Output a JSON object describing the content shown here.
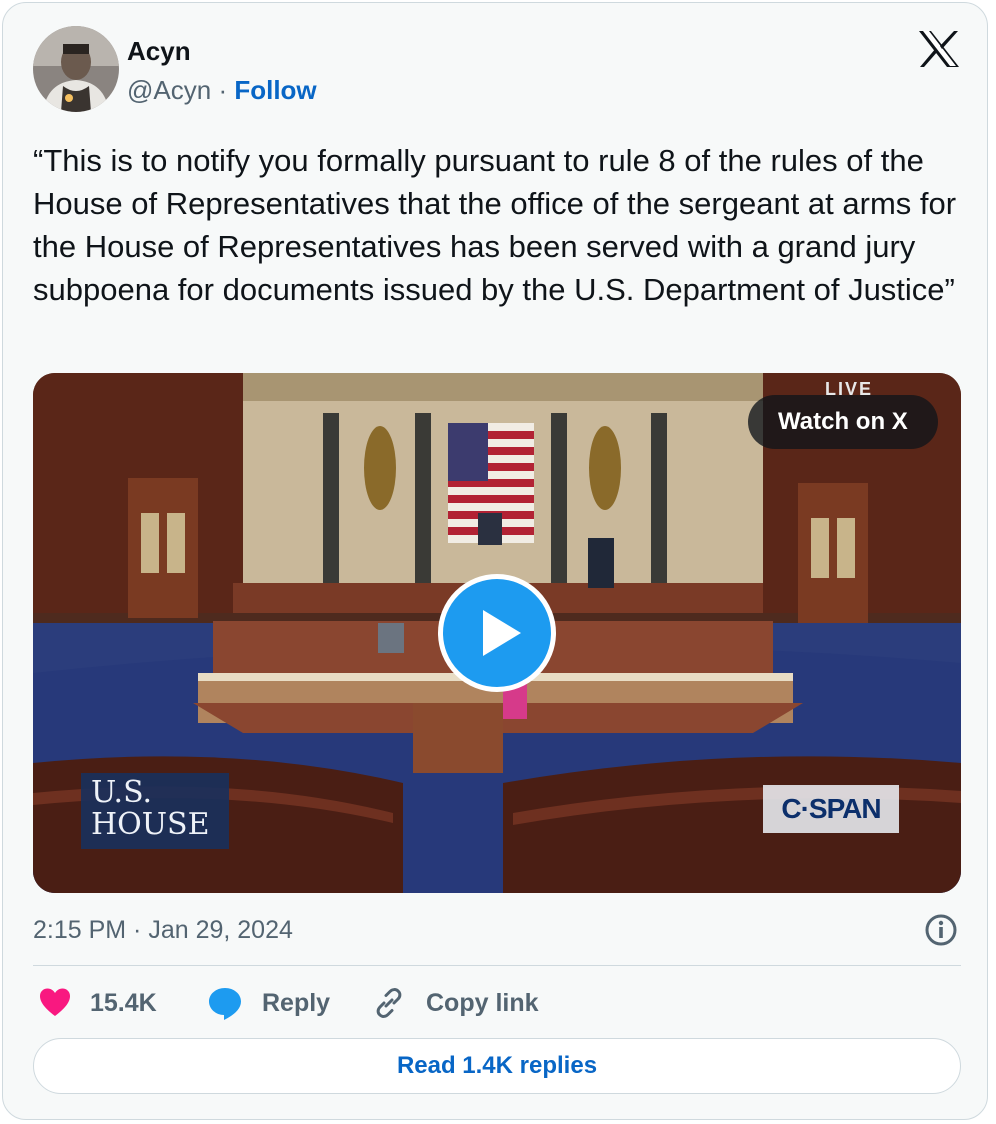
{
  "author": {
    "name": "Acyn",
    "handle": "@Acyn",
    "separator": "·",
    "follow_label": "Follow"
  },
  "platform_icon": "x-logo-icon",
  "tweet": {
    "text": "“This is to notify you formally pursuant to rule 8 of the rules of the House of Representatives that the office of the sergeant at arms for the House of Representatives has been served with a grand jury subpoena for documents issued by the U.S. Department of Justice”"
  },
  "media": {
    "watch_label": "Watch on X",
    "live_label": "LIVE",
    "network_logo": "C·SPAN",
    "chyron_line1": "U.S.",
    "chyron_line2": "HOUSE",
    "play_icon": "play-icon"
  },
  "timestamp": "2:15 PM · Jan 29, 2024",
  "actions": {
    "likes": {
      "icon": "heart-icon",
      "count": "15.4K"
    },
    "reply": {
      "icon": "reply-bubble-icon",
      "label": "Reply"
    },
    "copy": {
      "icon": "link-icon",
      "label": "Copy link"
    }
  },
  "read_replies_label": "Read 1.4K replies",
  "colors": {
    "accent": "#0866c6",
    "like": "#f91880",
    "reply": "#1d9bf0",
    "muted": "#536471"
  }
}
